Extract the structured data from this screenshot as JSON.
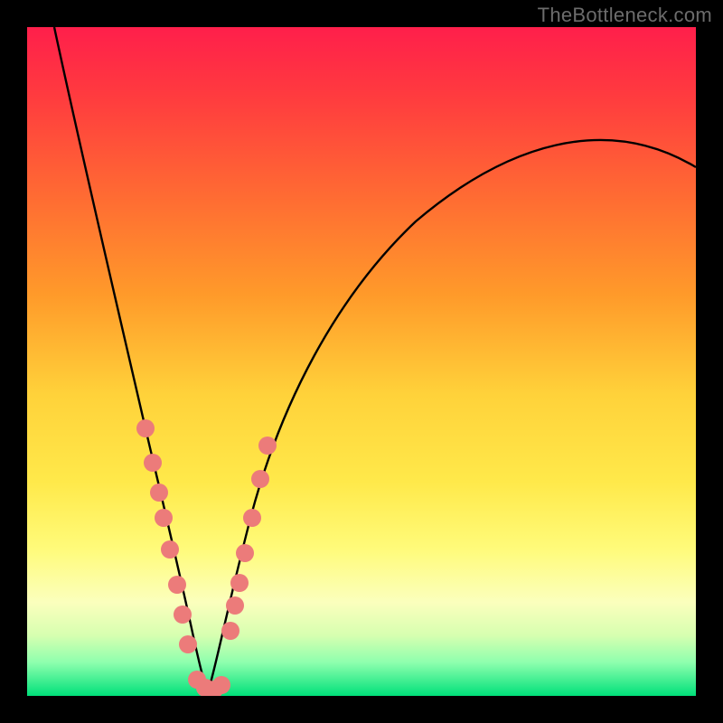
{
  "watermark": "TheBottleneck.com",
  "chart_data": {
    "type": "line",
    "title": "",
    "xlabel": "",
    "ylabel": "",
    "xlim": [
      0,
      100
    ],
    "ylim": [
      0,
      100
    ],
    "note": "Axes are unlabeled; values are normalized 0–100 estimates read from pixel positions. y≈0 is the green optimum, y≈100 is the red top edge. Two curves descend from upper-left and upper-right into a common minimum near x≈26.",
    "series": [
      {
        "name": "left-curve",
        "x": [
          4,
          7,
          10,
          13,
          15,
          17,
          19,
          20.5,
          22,
          23.5,
          25,
          26
        ],
        "y": [
          100,
          86,
          72,
          58,
          47,
          37,
          27,
          19,
          12,
          6,
          2,
          0.5
        ]
      },
      {
        "name": "right-curve",
        "x": [
          26,
          27,
          28.5,
          30,
          32,
          35,
          40,
          46,
          54,
          63,
          74,
          86,
          100
        ],
        "y": [
          0.5,
          1.5,
          5,
          10,
          17,
          26,
          38,
          48,
          57,
          64,
          70,
          75,
          79
        ]
      },
      {
        "name": "markers-left-branch",
        "x": [
          15.7,
          16.8,
          17.7,
          18.4,
          19.3,
          20.3,
          21.1,
          21.9
        ],
        "y": [
          44,
          38,
          33,
          29,
          24,
          18,
          13,
          8
        ]
      },
      {
        "name": "markers-trough",
        "x": [
          23.2,
          24.5,
          26.0,
          27.0
        ],
        "y": [
          2.0,
          0.9,
          0.6,
          1.3
        ]
      },
      {
        "name": "markers-right-branch",
        "x": [
          28.9,
          29.6,
          30.3,
          31.2,
          32.2,
          33.5,
          34.6
        ],
        "y": [
          10,
          14,
          17,
          21,
          27,
          33,
          39
        ]
      }
    ],
    "marker_color": "#ec7b7a",
    "curve_color": "#000000"
  }
}
